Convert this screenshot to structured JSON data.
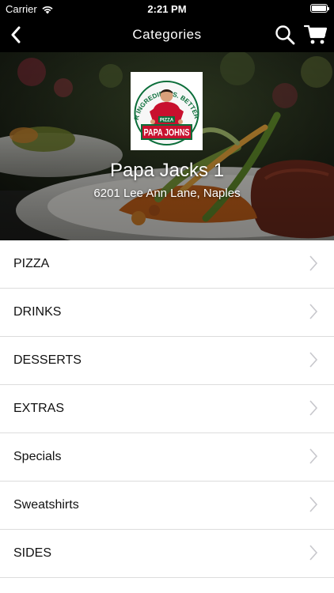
{
  "status_bar": {
    "carrier": "Carrier",
    "time": "2:21 PM"
  },
  "nav": {
    "title": "Categories",
    "back_icon": "chevron-left-icon",
    "search_icon": "search-icon",
    "cart_icon": "cart-icon"
  },
  "restaurant": {
    "name": "Papa Jacks 1",
    "address": "6201 Lee Ann Lane, Naples",
    "logo": {
      "arc_text": "BETTER INGREDIENTS. BETTER PIZZA.",
      "badge_text": "PIZZA",
      "brand_text": "PAPA JOHNS"
    }
  },
  "categories": [
    {
      "label": "PIZZA"
    },
    {
      "label": "DRINKS"
    },
    {
      "label": "DESSERTS"
    },
    {
      "label": "EXTRAS"
    },
    {
      "label": "Specials"
    },
    {
      "label": "Sweatshirts"
    },
    {
      "label": "SIDES"
    }
  ],
  "colors": {
    "bar_background": "#000000",
    "brand_red": "#c8102e",
    "brand_green": "#0b6e3a",
    "separator": "#dcdcdc",
    "chevron": "#c7c7cc"
  }
}
